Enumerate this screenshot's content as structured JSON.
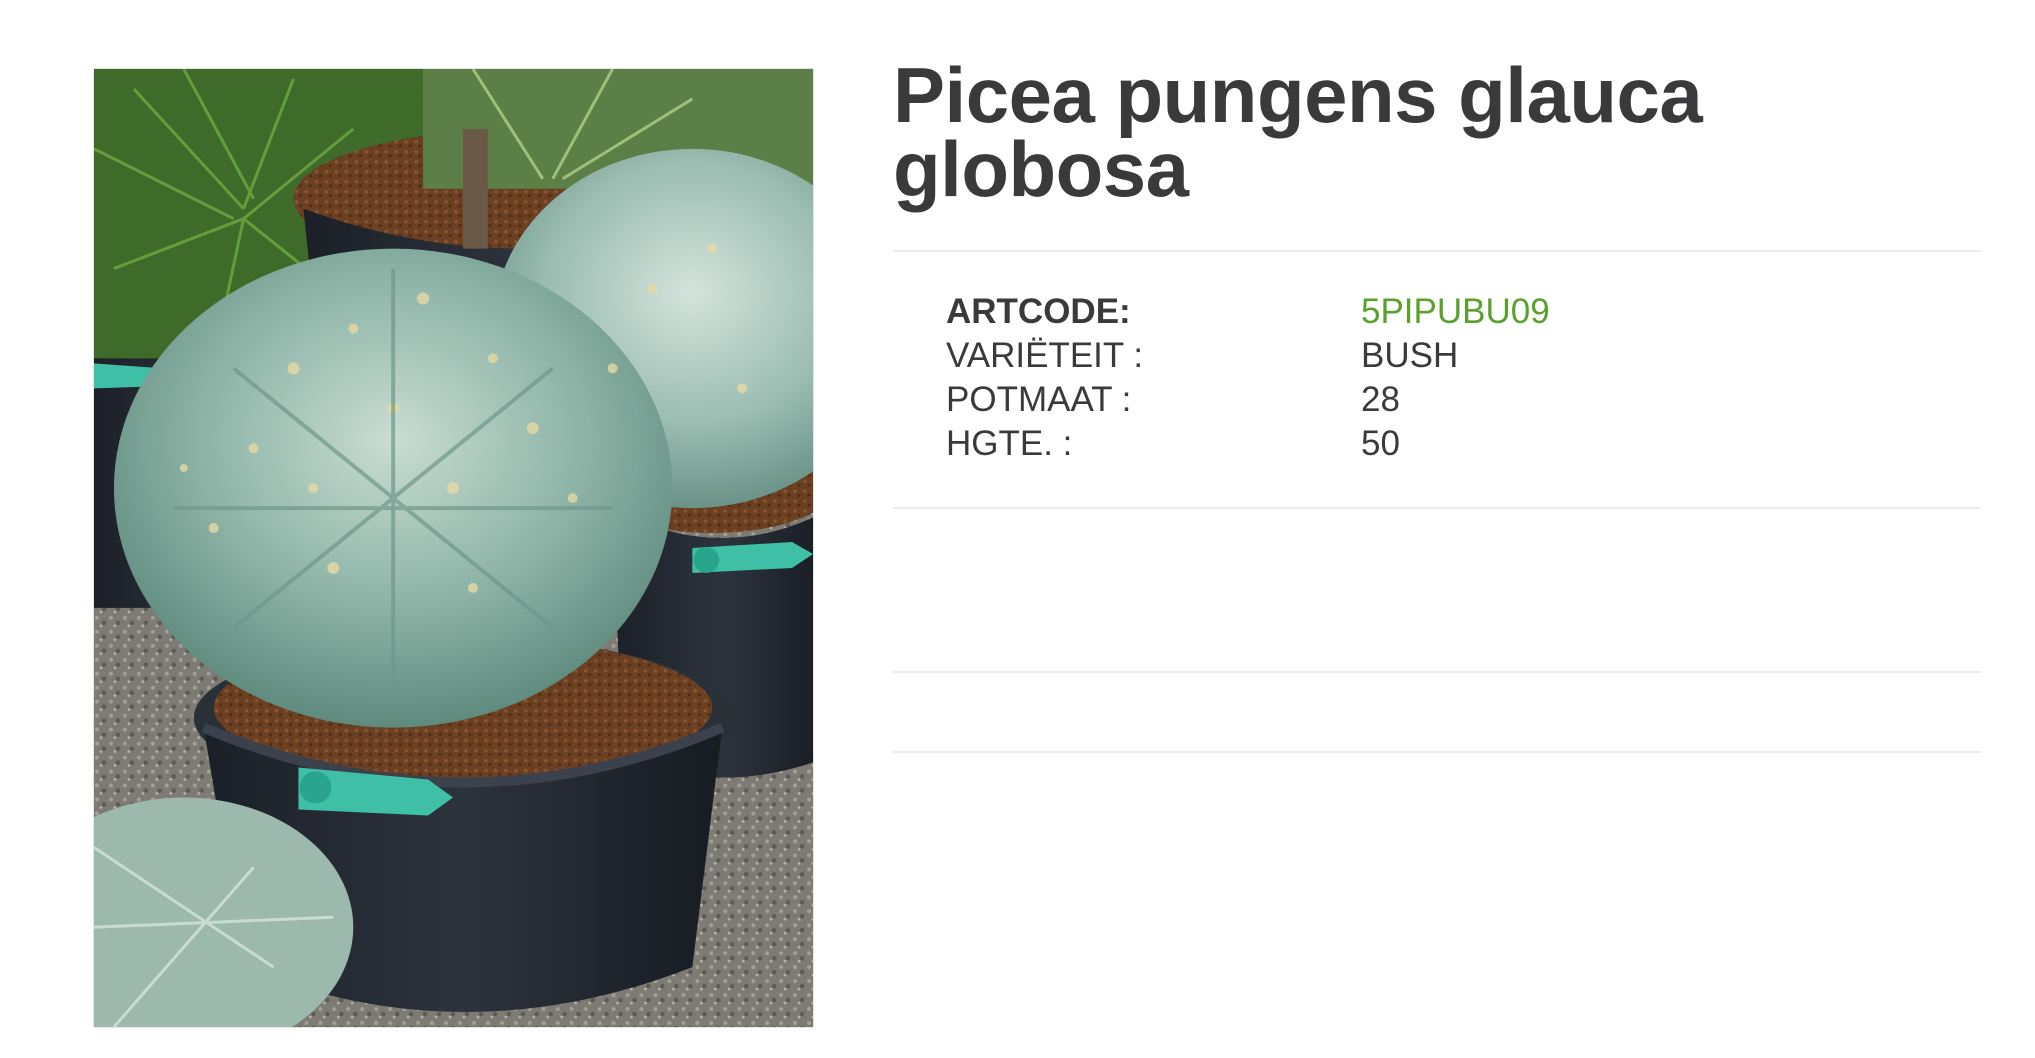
{
  "product": {
    "title": "Picea pungens glauca globosa",
    "image_alt": "Picea pungens glauca globosa in black nursery pot"
  },
  "specs": [
    {
      "label": "ARTCODE:",
      "value": "5PIPUBU09"
    },
    {
      "label": "VARIËTEIT :",
      "value": "BUSH"
    },
    {
      "label": "POTMAAT :",
      "value": "28"
    },
    {
      "label": "HGTE. :",
      "value": "50"
    }
  ],
  "colors": {
    "title": "#3a3a3c",
    "accent": "#5aa02c",
    "divider": "#ececec"
  }
}
